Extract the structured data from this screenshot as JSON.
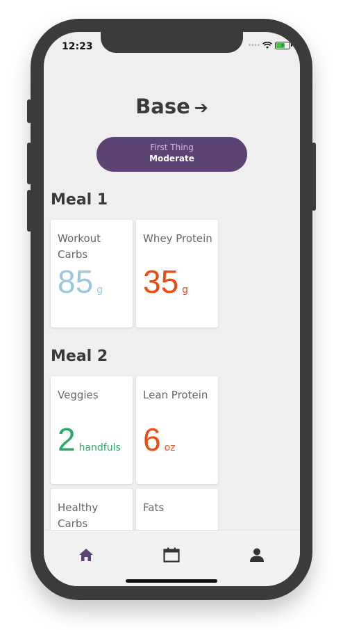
{
  "status_bar": {
    "time": "12:23"
  },
  "header": {
    "title": "Base",
    "arrow_glyph": "➔"
  },
  "schedule": {
    "label": "First Thing",
    "intensity": "Moderate"
  },
  "meals": [
    {
      "title": "Meal 1",
      "items": [
        {
          "label": "Workout Carbs",
          "value": "85",
          "unit": "g",
          "color": "#9bc8da"
        },
        {
          "label": "Whey Protein",
          "value": "35",
          "unit": "g",
          "color": "#ee4b12"
        }
      ]
    },
    {
      "title": "Meal 2",
      "items": [
        {
          "label": "Veggies",
          "value": "2",
          "unit": "handfuls",
          "color": "#2aa865"
        },
        {
          "label": "Lean Protein",
          "value": "6",
          "unit": "oz",
          "color": "#ee4b12"
        },
        {
          "label": "Healthy Carbs",
          "value": "",
          "unit": "",
          "color": "#9bc8da"
        },
        {
          "label": "Fats",
          "value": "",
          "unit": "",
          "color": "#666666"
        }
      ]
    }
  ],
  "tab_bar": {
    "tabs": [
      {
        "icon": "home-icon",
        "active": true
      },
      {
        "icon": "calendar-icon",
        "active": false
      },
      {
        "icon": "user-icon",
        "active": false
      }
    ],
    "active_color": "#5b4374",
    "inactive_color": "#333333"
  },
  "theme": {
    "accent": "#5b4374",
    "background": "#efefef"
  }
}
